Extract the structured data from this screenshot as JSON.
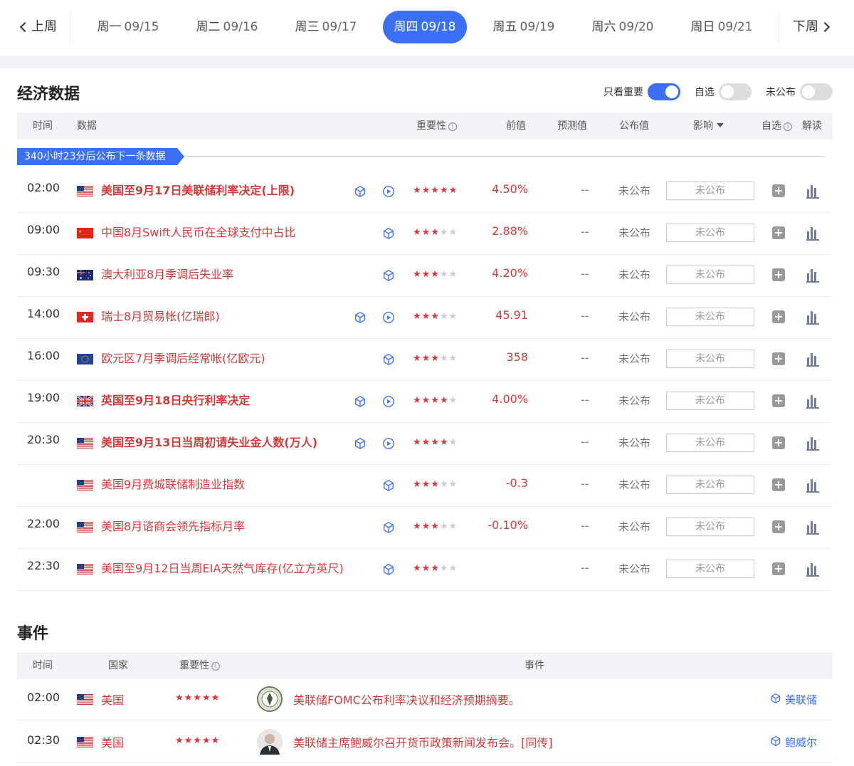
{
  "week_nav": {
    "prev_label": "上周",
    "next_label": "下周",
    "days": [
      {
        "name": "周一",
        "date": "09/15"
      },
      {
        "name": "周二",
        "date": "09/16"
      },
      {
        "name": "周三",
        "date": "09/17"
      },
      {
        "name": "周四",
        "date": "09/18",
        "active": true
      },
      {
        "name": "周五",
        "date": "09/19"
      },
      {
        "name": "周六",
        "date": "09/20"
      },
      {
        "name": "周日",
        "date": "09/21"
      }
    ]
  },
  "econ": {
    "title": "经济数据",
    "toggles": [
      {
        "label": "只看重要",
        "on": true
      },
      {
        "label": "自选",
        "on": false
      },
      {
        "label": "未公布",
        "on": false
      }
    ],
    "columns": {
      "time": "时间",
      "data": "数据",
      "importance": "重要性",
      "previous": "前值",
      "forecast": "预测值",
      "actual": "公布值",
      "impact": "影响",
      "watch": "自选",
      "interpret": "解读"
    },
    "countdown": "340小时23分后公布下一条数据",
    "placeholder": "--",
    "unpublished": "未公布",
    "add_symbol": "+",
    "rows": [
      {
        "time": "02:00",
        "flag": "us",
        "name": "美国至9月17日美联储利率决定(上限)",
        "bold": true,
        "cube": true,
        "play": true,
        "stars": 5,
        "previous": "4.50%"
      },
      {
        "time": "09:00",
        "flag": "cn",
        "name": "中国8月Swift人民币在全球支付中占比",
        "bold": false,
        "cube": true,
        "play": false,
        "stars": 3,
        "previous": "2.88%"
      },
      {
        "time": "09:30",
        "flag": "au",
        "name": "澳大利亚8月季调后失业率",
        "bold": false,
        "cube": true,
        "play": false,
        "stars": 3,
        "previous": "4.20%"
      },
      {
        "time": "14:00",
        "flag": "ch",
        "name": "瑞士8月贸易帐(亿瑞郎)",
        "bold": false,
        "cube": true,
        "play": true,
        "stars": 3,
        "previous": "45.91"
      },
      {
        "time": "16:00",
        "flag": "eu",
        "name": "欧元区7月季调后经常帐(亿欧元)",
        "bold": false,
        "cube": true,
        "play": false,
        "stars": 3,
        "previous": "358"
      },
      {
        "time": "19:00",
        "flag": "gb",
        "name": "英国至9月18日央行利率决定",
        "bold": true,
        "cube": true,
        "play": true,
        "stars": 4,
        "previous": "4.00%"
      },
      {
        "time": "20:30",
        "flag": "us",
        "name": "美国至9月13日当周初请失业金人数(万人)",
        "bold": true,
        "cube": true,
        "play": true,
        "stars": 4,
        "previous": ""
      },
      {
        "time": "",
        "flag": "us",
        "name": "美国9月费城联储制造业指数",
        "bold": false,
        "cube": true,
        "play": false,
        "stars": 3,
        "previous": "-0.3"
      },
      {
        "time": "22:00",
        "flag": "us",
        "name": "美国8月谘商会领先指标月率",
        "bold": false,
        "cube": true,
        "play": false,
        "stars": 3,
        "previous": "-0.10%"
      },
      {
        "time": "22:30",
        "flag": "us",
        "name": "美国至9月12日当周EIA天然气库存(亿立方英尺)",
        "bold": false,
        "cube": true,
        "play": false,
        "stars": 3,
        "previous": ""
      }
    ]
  },
  "events": {
    "title": "事件",
    "columns": {
      "time": "时间",
      "country": "国家",
      "importance": "重要性",
      "event": "事件"
    },
    "rows": [
      {
        "time": "02:00",
        "flag": "us",
        "country": "美国",
        "stars": 5,
        "avatar": "fed-seal",
        "text": "美联储FOMC公布利率决议和经济预期摘要。",
        "tag": "美联储"
      },
      {
        "time": "02:30",
        "flag": "us",
        "country": "美国",
        "stars": 5,
        "avatar": "person",
        "text": "美联储主席鲍威尔召开货币政策新闻发布会。[同传]",
        "tag": "鲍威尔"
      }
    ]
  }
}
